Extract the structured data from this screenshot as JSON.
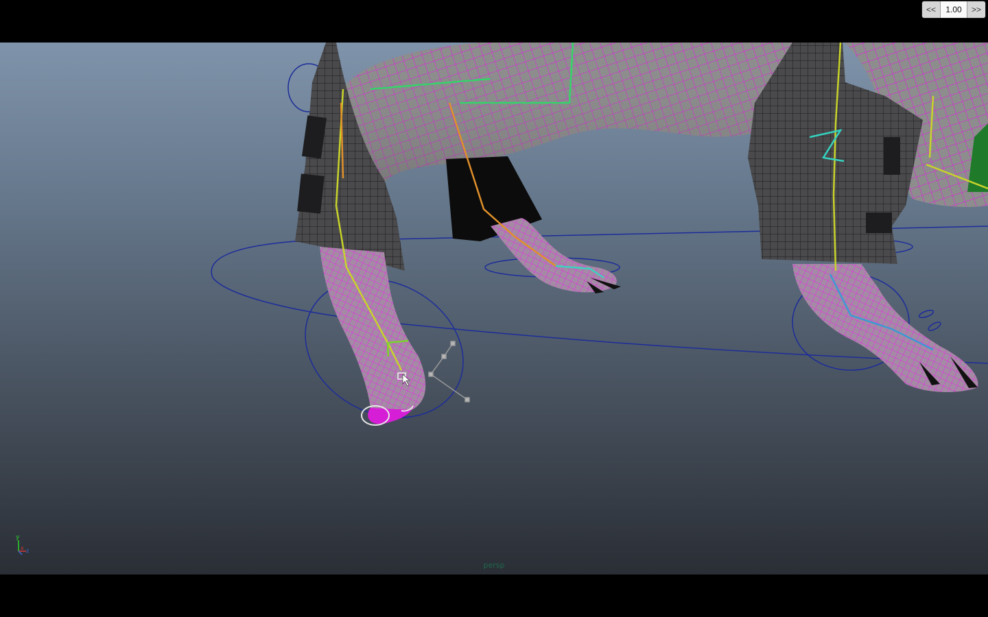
{
  "playback": {
    "rewind_label": "<<",
    "speed_value": "1.00",
    "forward_label": ">>"
  },
  "viewport": {
    "camera_name": "persp"
  },
  "axis_gizmo": {
    "y_label": "y",
    "x_label": "x",
    "z_label": "z"
  },
  "colors": {
    "wireframe_selected": "#e020e0",
    "nurbs_controls": "#1c2c9a",
    "joint_chain_yellow": "#c8d32a",
    "joint_chain_green": "#35d36a",
    "camera_label": "#1f6a4c"
  }
}
